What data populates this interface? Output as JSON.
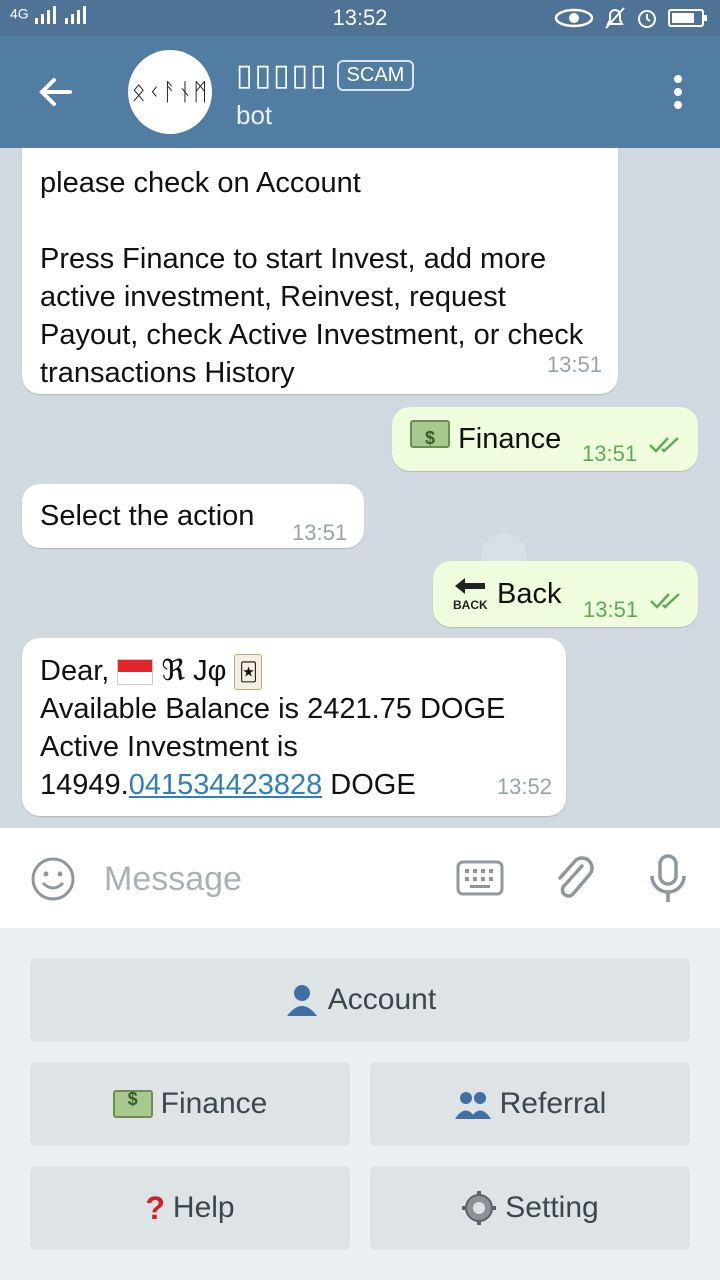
{
  "statusbar": {
    "network": "4G",
    "time": "13:52"
  },
  "header": {
    "title": "▯▯▯▯▯",
    "avatar_text": "ᛟᚲᚨᚾᛗ",
    "badge": "SCAM",
    "subtitle": "bot"
  },
  "messages": [
    {
      "direction": "in",
      "line1": "please check on Account",
      "line2": "Press Finance to start Invest, add more active investment, Reinvest, request Payout, check Active Investment, or check transactions History",
      "time": "13:51"
    },
    {
      "direction": "out",
      "text": "Finance",
      "time": "13:51",
      "icon": "money-icon"
    },
    {
      "direction": "in",
      "text": "Select the action",
      "time": "13:51"
    },
    {
      "direction": "out",
      "text": "Back",
      "time": "13:51",
      "icon": "back-arrow-icon"
    },
    {
      "direction": "in",
      "greeting": "Dear,",
      "name": "ℜ Jφ",
      "balance_line": "Available Balance is 2421.75 DOGE",
      "active_line": "Active Investment is",
      "amount_prefix": "14949.",
      "amount_link": "041534423828",
      "amount_suffix": " DOGE",
      "time": "13:52"
    }
  ],
  "input": {
    "placeholder": "Message"
  },
  "keyboard": {
    "account": "Account",
    "finance": "Finance",
    "referral": "Referral",
    "help": "Help",
    "setting": "Setting"
  },
  "colors": {
    "header": "#527da3",
    "outgoing_bubble": "#effdde",
    "incoming_bubble": "#ffffff",
    "link": "#2f7fbf",
    "check": "#5fab55"
  }
}
